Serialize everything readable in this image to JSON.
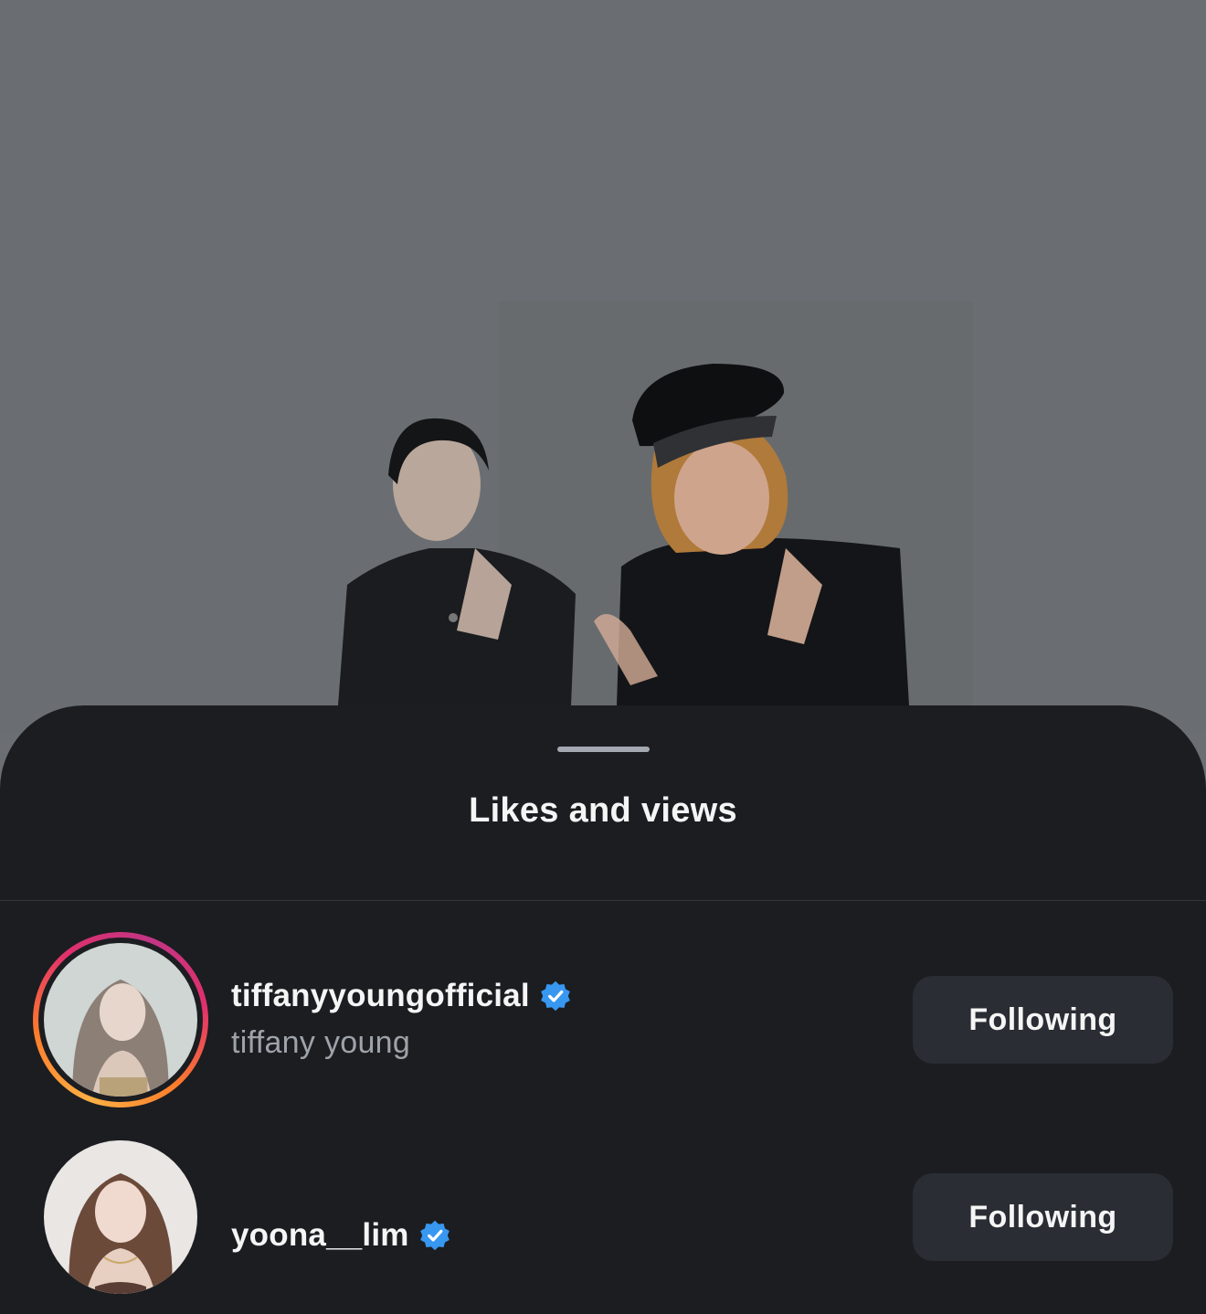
{
  "background_image": {
    "description_icon": "video-frame-two-performers"
  },
  "sheet": {
    "title": "Likes and views"
  },
  "likes": [
    {
      "username": "tiffanyyoungofficial",
      "full_name": "tiffany young",
      "verified": true,
      "has_story_ring": true,
      "button_label": "Following"
    },
    {
      "username": "yoona__lim",
      "full_name": "",
      "verified": true,
      "has_story_ring": false,
      "button_label": "Following"
    }
  ],
  "colors": {
    "sheet_bg": "#1b1d21",
    "button_bg": "#2a2d33",
    "verified_blue": "#3897f0",
    "secondary_text": "#9ea2a9"
  }
}
